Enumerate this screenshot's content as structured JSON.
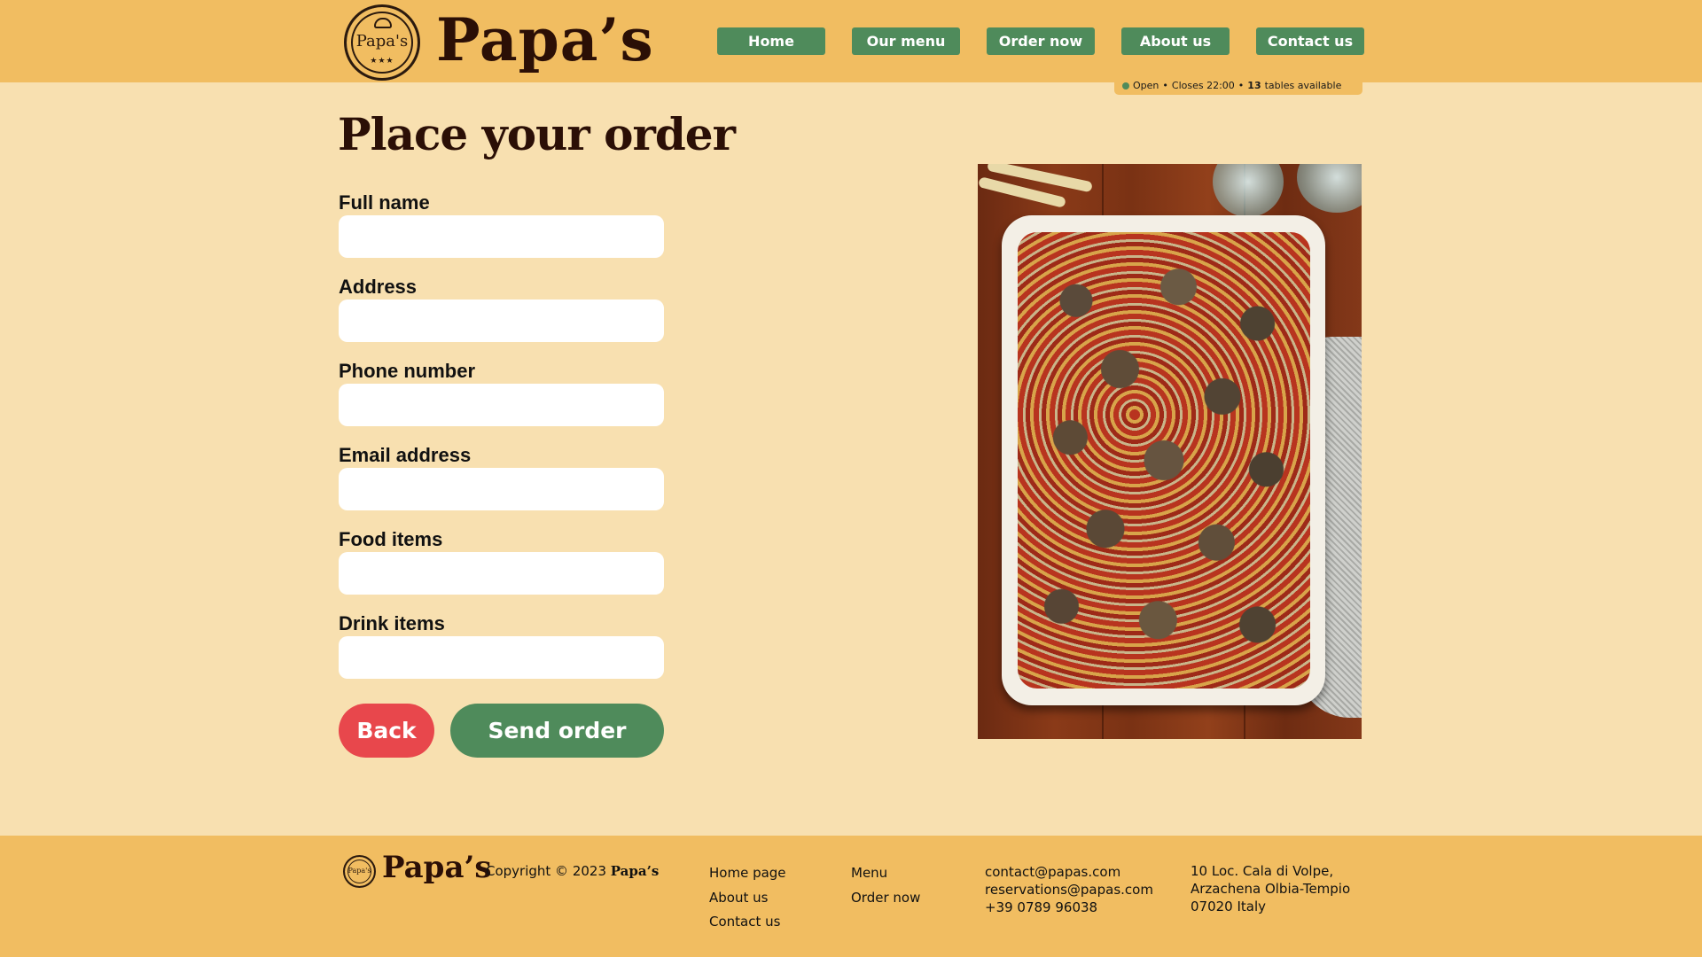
{
  "header": {
    "brand": "Papa’s",
    "logo_text": "Papa's",
    "nav": [
      "Home",
      "Our menu",
      "Order now",
      "About us",
      "Contact us"
    ],
    "status": {
      "open": "Open",
      "closes": "Closes 22:00",
      "tables_count": "13",
      "tables_text": "tables available"
    }
  },
  "main": {
    "title": "Place your order",
    "fields": [
      {
        "label": "Full name",
        "value": ""
      },
      {
        "label": "Address",
        "value": ""
      },
      {
        "label": "Phone number",
        "value": ""
      },
      {
        "label": "Email address",
        "value": ""
      },
      {
        "label": "Food items",
        "value": ""
      },
      {
        "label": "Drink items",
        "value": ""
      }
    ],
    "back_label": "Back",
    "send_label": "Send order"
  },
  "footer": {
    "brand": "Papa’s",
    "logo_text": "Papa's",
    "copyright_prefix": "Copyright © 2023",
    "copyright_brand": "Papa’s",
    "links_col1": [
      "Home page",
      "About us",
      "Contact us"
    ],
    "links_col2": [
      "Menu",
      "Order now"
    ],
    "contact": [
      "contact@papas.com",
      "reservations@papas.com",
      "+39 0789 96038"
    ],
    "address": [
      "10 Loc. Cala di Volpe,",
      "Arzachena Olbia-Tempio",
      "07020 Italy"
    ]
  },
  "colors": {
    "header_bg": "#f1bd61",
    "page_bg": "#f8e0b0",
    "accent_green": "#4f8b5b",
    "accent_red": "#e8474c",
    "brand_dark": "#2b0f06"
  },
  "icons": {
    "logo": "chef-hat-seal-icon",
    "status_dot": "status-dot-icon"
  }
}
